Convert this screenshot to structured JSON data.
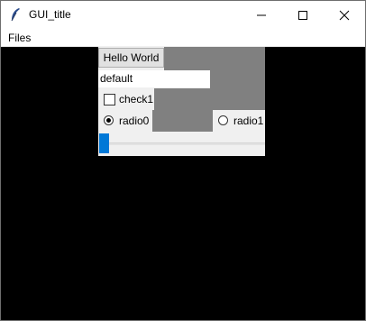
{
  "window": {
    "title": "GUI_title"
  },
  "menu": {
    "items": [
      "Files"
    ]
  },
  "widgets": {
    "hello_button": "Hello World",
    "entry_value": "default",
    "checkbox": {
      "label": "check1",
      "checked": false
    },
    "radios": [
      {
        "label": "radio0",
        "selected": true
      },
      {
        "label": "radio1",
        "selected": false
      }
    ],
    "scale": {
      "value_fraction": 0.0
    }
  },
  "colors": {
    "window_background": "#000000",
    "panel_background": "#f0f0f0",
    "gray_fill": "#808080",
    "scale_thumb": "#0078d7"
  }
}
